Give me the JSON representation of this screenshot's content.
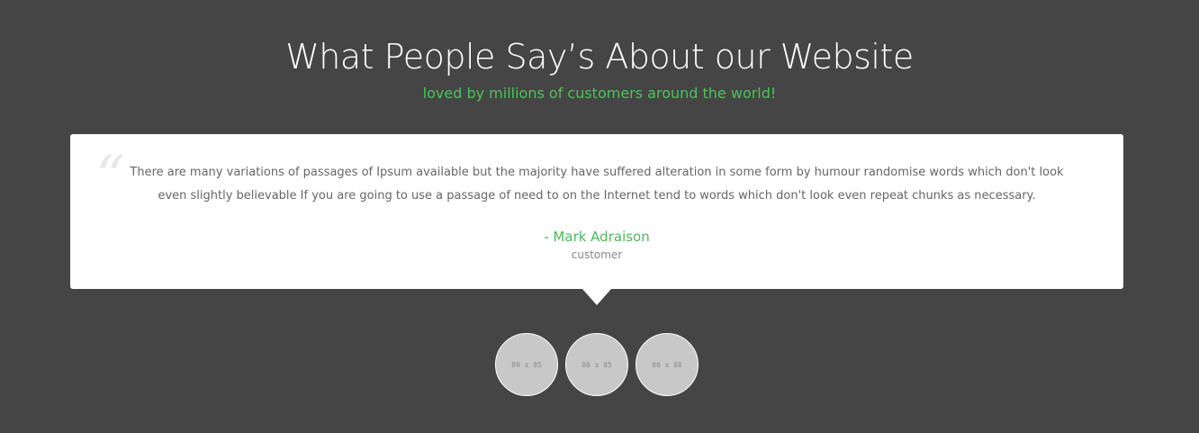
{
  "section": {
    "title": "What People Say’s About our Website",
    "subtitle": "loved by millions of customers around the world!"
  },
  "testimonial": {
    "quote_icon": "quote-open-icon",
    "quote_mark": "“",
    "text": "There are many variations of passages of Ipsum available but the majority have suffered alteration in some form by humour randomise words which don't look even slightly believable If you are going to use a passage of need to on the Internet tend to words which don't look even repeat chunks as necessary.",
    "author": "- Mark Adraison",
    "role": "customer"
  },
  "thumbnails": [
    {
      "label": "80 x 85"
    },
    {
      "label": "80 x 85"
    },
    {
      "label": "80 x 88"
    }
  ],
  "colors": {
    "background": "#454545",
    "accent": "#4cc35a",
    "card": "#ffffff"
  }
}
